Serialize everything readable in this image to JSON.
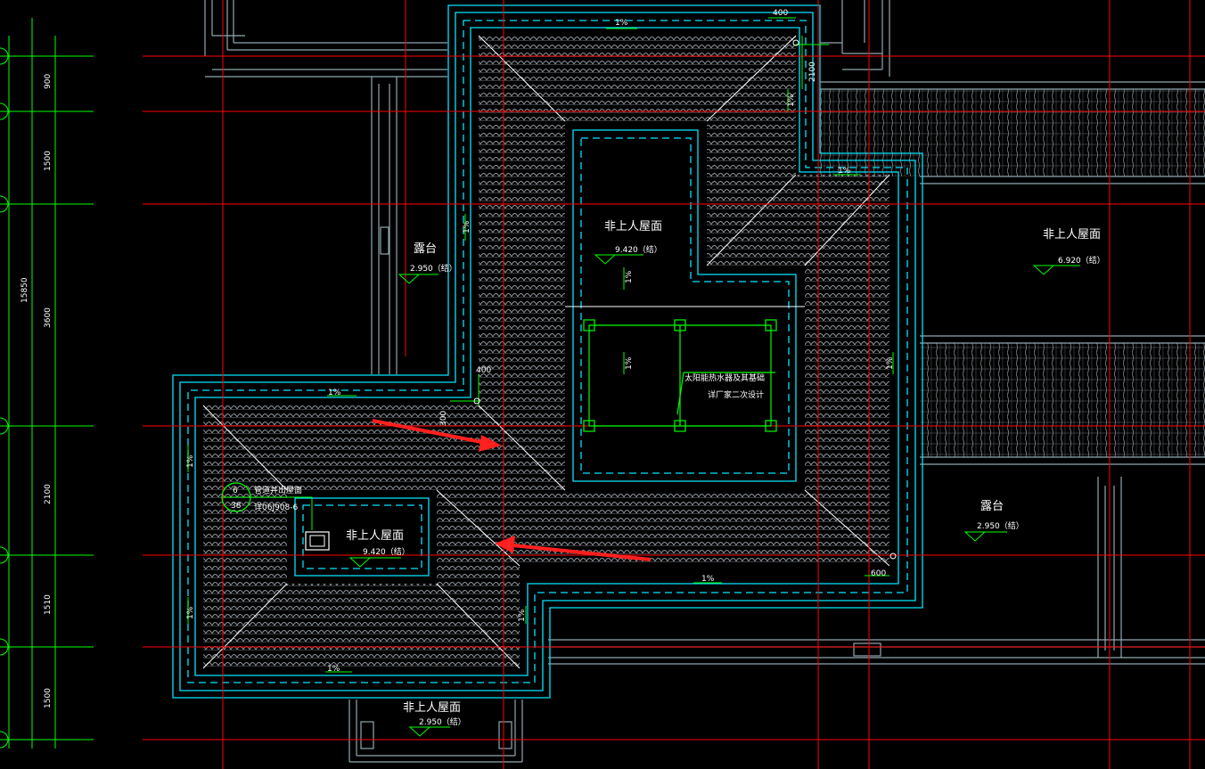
{
  "drawing": {
    "background": "#000000",
    "colors": {
      "axis": "#ff0000",
      "wall": "#00e5ff",
      "wall_dim": "#8fa8b0",
      "dim": "#00ff00",
      "ridge": "#ffffff",
      "arrow": "#ff2020",
      "tile": "#9aa0a6"
    },
    "left_dims": [
      "900",
      "1500",
      "3600",
      "2100",
      "1510",
      "1500"
    ],
    "left_total": "15850",
    "labels": {
      "terrace_top_left": "露台",
      "terrace_top_left_elev": "2.950（结）",
      "roof_top_center": "非上人屋面",
      "roof_top_center_elev": "9.420（结）",
      "roof_right": "非上人屋面",
      "roof_right_elev": "6.920（结）",
      "roof_lower_center": "非上人屋面",
      "roof_lower_center_elev": "9.420（结）",
      "terrace_right": "露台",
      "terrace_right_elev": "2.950（结）",
      "roof_bottom": "非上人屋面",
      "roof_bottom_elev": "2.950（结）",
      "solar_note_1": "太阳能热水器及其基础",
      "solar_note_2": "详厂家二次设计",
      "vent_note_1": "管道井出屋面",
      "vent_note_2": "详06J908-6",
      "detail_top": "6",
      "detail_bottom": "38"
    },
    "slopes": [
      "1%",
      "1%",
      "1%",
      "1%",
      "1%",
      "1%",
      "1%",
      "1%",
      "1%",
      "1%",
      "1%",
      "1%",
      "1%",
      "1%"
    ],
    "dims": {
      "d400_top": "400",
      "d2100_top": "2100",
      "d400_mid": "400",
      "d300_mid": "300",
      "d600_right": "600"
    }
  }
}
